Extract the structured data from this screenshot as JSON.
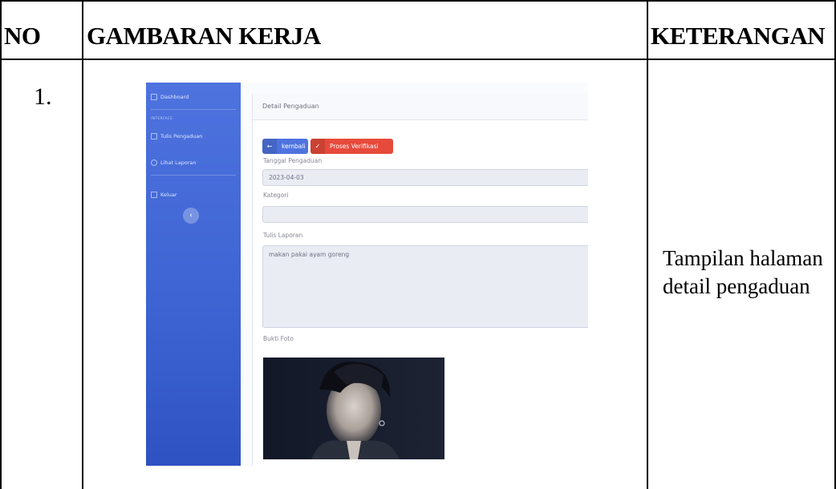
{
  "table": {
    "headers": {
      "no": "NO",
      "work": "GAMBARAN KERJA",
      "note": "KETERANGAN"
    },
    "rows": [
      {
        "no": "1.",
        "note": "Tampilan halaman detail pengaduan"
      }
    ]
  },
  "screenshot": {
    "sidebar": {
      "items": [
        {
          "label": "Dashboard",
          "icon": "dashboard-icon"
        },
        {
          "label": "Tulis Pengaduan",
          "icon": "edit-icon"
        },
        {
          "label": "Lihat Laporan",
          "icon": "search-icon"
        },
        {
          "label": "Keluar",
          "icon": "logout-icon"
        }
      ],
      "heading": "INTERFACE",
      "toggle_glyph": "‹"
    },
    "card": {
      "title": "Detail Pengaduan",
      "buttons": {
        "back_label": "kembali",
        "back_icon_glyph": "←",
        "verify_label": "Proses Verifikasi",
        "verify_icon_glyph": "✓"
      },
      "fields": {
        "date_label": "Tanggal Pengaduan",
        "date_value": "2023-04-03",
        "category_label": "Kategori",
        "category_value": "",
        "report_label": "Tulis Laporan",
        "report_value": "makan pakai ayam goreng",
        "photo_label": "Bukti Foto"
      }
    },
    "colors": {
      "sidebar": "#4e73df",
      "back_button": "#4e73df",
      "verify_button": "#e74a3b",
      "input_bg": "#eaecf4"
    }
  }
}
